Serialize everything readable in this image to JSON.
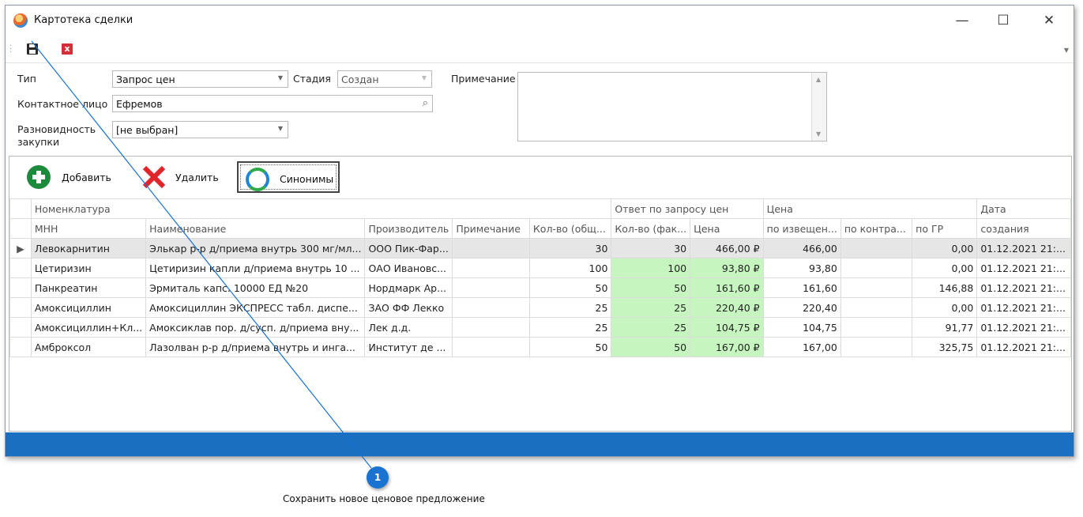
{
  "window": {
    "title": "Картотека сделки",
    "controls": [
      "—",
      "☐",
      "✕"
    ]
  },
  "toolbar": {
    "save_icon": "save-icon",
    "close_icon": "delete-icon"
  },
  "form": {
    "type_label": "Тип",
    "type_value": "Запрос цен",
    "stage_label": "Стадия",
    "stage_value": "Создан",
    "note_label": "Примечание",
    "note_value": "",
    "contact_label": "Контактное лицо",
    "contact_value": "Ефремов",
    "variety_label": "Разновидность закупки",
    "variety_value": "[не выбран]"
  },
  "actions": {
    "add": "Добавить",
    "delete": "Удалить",
    "synonyms": "Синонимы"
  },
  "grid": {
    "group_headers": {
      "nomenclature": "Номенклатура",
      "response": "Ответ по запросу цен",
      "price": "Цена",
      "date": "Дата"
    },
    "columns": [
      "МНН",
      "Наименование",
      "Производитель",
      "Примечание",
      "Кол-во (общ...",
      "Кол-во (фак...",
      "Цена",
      "по извещен...",
      "по контра...",
      "по ГР",
      "создания"
    ],
    "rows": [
      [
        "Левокарнитин",
        "Элькар р-р д/приема внутрь 300 мг/мл...",
        "ООО Пик-Фар...",
        "",
        "30",
        "30",
        "466,00 ₽",
        "466,00",
        "",
        "0,00",
        "01.12.2021 21:..."
      ],
      [
        "Цетиризин",
        "Цетиризин капли д/приема внутрь 10 ...",
        "ОАО Ивановс...",
        "",
        "100",
        "100",
        "93,80 ₽",
        "93,80",
        "",
        "0,00",
        "01.12.2021 21:..."
      ],
      [
        "Панкреатин",
        "Эрмиталь капс. 10000 ЕД №20",
        "Нордмарк Ар...",
        "",
        "50",
        "50",
        "161,60 ₽",
        "161,60",
        "",
        "146,88",
        "01.12.2021 21:..."
      ],
      [
        "Амоксициллин",
        "Амоксициллин ЭКСПРЕСС табл. диспе...",
        "ЗАО ФФ Лекко",
        "",
        "25",
        "25",
        "220,40 ₽",
        "220,40",
        "",
        "0,00",
        "01.12.2021 21:..."
      ],
      [
        "Амоксициллин+Кл...",
        "Амоксиклав пор. д/сусп. д/приема вну...",
        "Лек д.д.",
        "",
        "25",
        "25",
        "104,75 ₽",
        "104,75",
        "",
        "91,77",
        "01.12.2021 21:..."
      ],
      [
        "Амброксол",
        "Лазолван р-р д/приема внутрь и инга...",
        "Институт де ...",
        "",
        "50",
        "50",
        "167,00 ₽",
        "167,00",
        "",
        "325,75",
        "01.12.2021 21:..."
      ]
    ]
  },
  "callout": {
    "number": "1",
    "text": "Сохранить новое ценовое предложение"
  },
  "colors": {
    "status_bar": "#1a6fc0",
    "highlight": "#c6f5c0",
    "callout": "#1a73d1"
  }
}
